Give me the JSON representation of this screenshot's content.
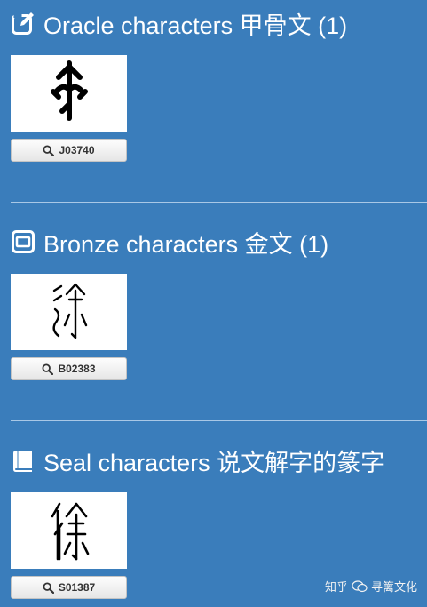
{
  "sections": [
    {
      "title": "Oracle characters 甲骨文 (1)",
      "icon": "edit-square-icon",
      "button_label": "J03740"
    },
    {
      "title": "Bronze characters 金文 (1)",
      "icon": "bronze-vessel-icon",
      "button_label": "B02383"
    },
    {
      "title": "Seal characters 说文解字的篆字",
      "icon": "book-icon",
      "button_label": "S01387"
    }
  ],
  "watermark": {
    "left_text": "知乎",
    "right_text": "寻篱文化"
  },
  "colors": {
    "background": "#3a7dbb",
    "card": "#ffffff",
    "button_text": "#333333",
    "divider": "#a9c8e6"
  }
}
